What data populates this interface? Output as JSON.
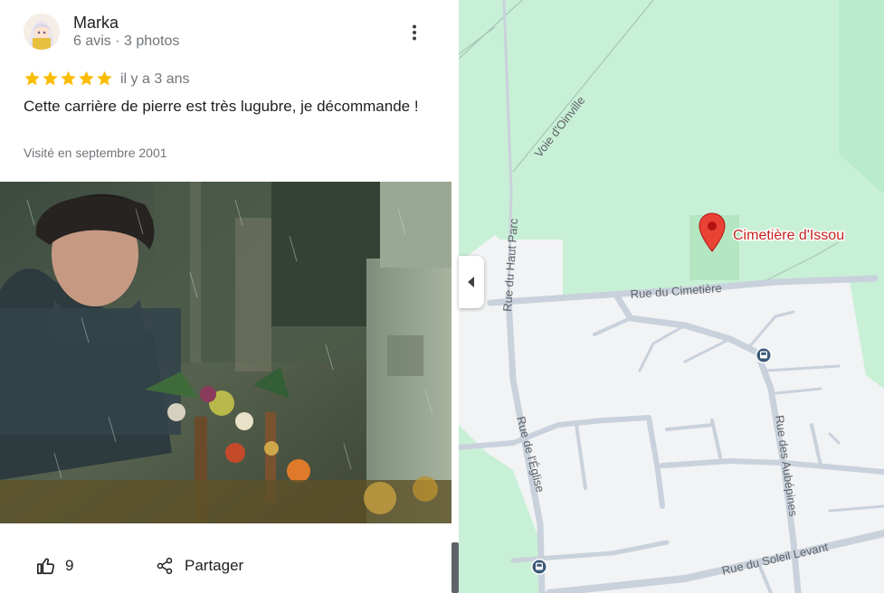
{
  "review": {
    "author_name": "Marka",
    "author_meta": "6 avis · 3 photos",
    "rating": 5,
    "date": "il y a 3 ans",
    "text": "Cette carrière de pierre est très lugubre, je décommande !",
    "visited": "Visité en septembre 2001",
    "photo_icon": "review-photo"
  },
  "actions": {
    "like_count": "9",
    "share_label": "Partager"
  },
  "map": {
    "place_name": "Cimetière d'Issou",
    "streets": {
      "voie_oinville": "Voie d'Oinville",
      "rue_haut_parc": "Rue du Haut Parc",
      "rue_cimetiere": "Rue du Cimetière",
      "rue_eglise": "Rue de l'Église",
      "rue_aubepines": "Rue des Aubépines",
      "rue_soleil_levant": "Rue du Soleil Levant"
    }
  },
  "colors": {
    "star": "#fbbc04",
    "place_label": "#c5221f",
    "pin": "#ea4335",
    "map_green": "#c8f0d6",
    "map_land": "#f1f3f4",
    "road": "#c9d1dc"
  }
}
